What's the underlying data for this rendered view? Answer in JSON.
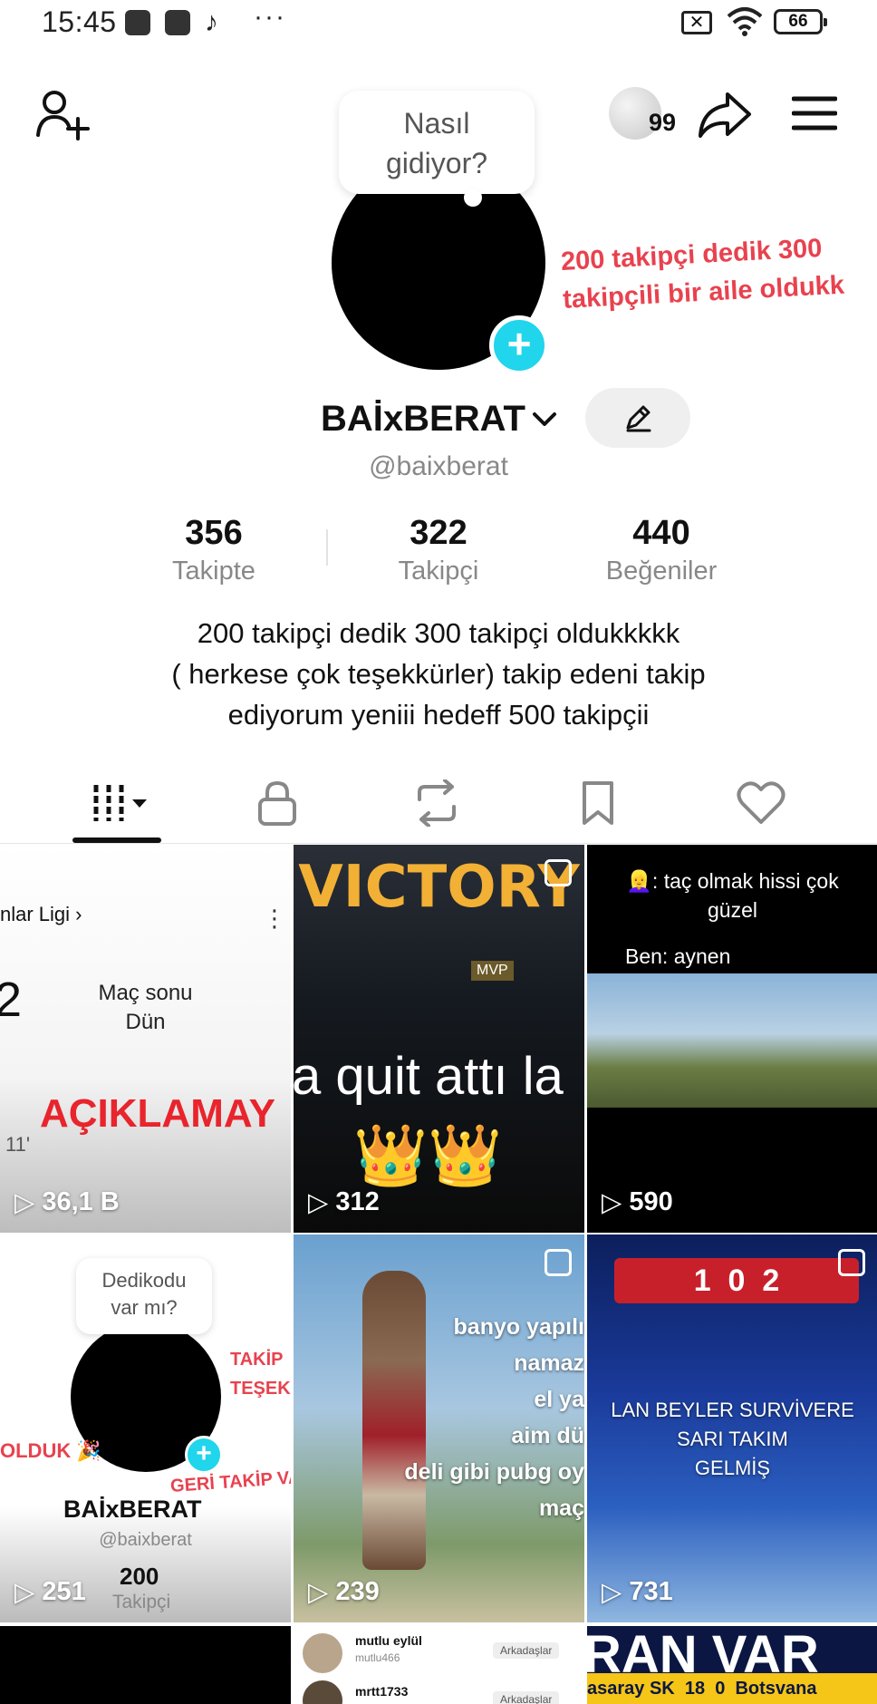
{
  "status": {
    "time": "15:45",
    "dots": "···",
    "battery": "66",
    "close_badge": "✕"
  },
  "header": {
    "coin_count": "99"
  },
  "profile": {
    "bubble_line1": "Nasıl",
    "bubble_line2": "gidiyor?",
    "side_note": "200 takipçi dedik 300 takipçili bir aile oldukk",
    "name": "BAİxBERAT",
    "handle": "@baixberat",
    "stats": [
      {
        "num": "356",
        "label": "Takipte"
      },
      {
        "num": "322",
        "label": "Takipçi"
      },
      {
        "num": "440",
        "label": "Beğeniler"
      }
    ],
    "bio_lines": [
      "200 takipçi dedik 300 takipçi oldukkkkk",
      "( herkese çok teşekkürler) takip edeni takip",
      "ediyorum yeniii hedeff 500 takipçii"
    ]
  },
  "colors": {
    "accent": "#20d5ec",
    "note_red": "#e8424f"
  },
  "videos": [
    {
      "views": "36,1 B",
      "t1": "nlar Ligi ›",
      "t2": "Maç sonu",
      "t3": "Dün",
      "t4": "2",
      "t5": "AÇIKLAMAY",
      "t6": "11'"
    },
    {
      "views": "312",
      "t1": "VICTORY",
      "t2": "a quit attı la",
      "t3": "MVP",
      "crowns": "👑👑"
    },
    {
      "views": "590",
      "t1": "👱‍♀️: taç olmak hissi çok",
      "t2": "güzel",
      "t3": "Ben: aynen"
    },
    {
      "views": "251",
      "t1": "Dedikodu",
      "t2": "var mı?",
      "t3": "BAİxBERAT",
      "t4": "@baixberat",
      "t5": "200",
      "t6": "Takipçi",
      "t7": "OLDUK 🎉",
      "t8": "TAKİP",
      "t9": "TEŞEK",
      "t10": "GERİ TAKİP VA"
    },
    {
      "views": "239",
      "t1": "banyo yapılı",
      "t2": "namaz",
      "t3": "el ya",
      "t4": "aim dü",
      "t5": "deli gibi pubg oy",
      "t6": "maç"
    },
    {
      "views": "731",
      "t1": "LAN BEYLER SURVİVERE",
      "t2": "SARI TAKIM",
      "t3": "GELMİŞ",
      "score": "1  0  2"
    },
    {
      "views": "",
      "t1": ""
    },
    {
      "views": "",
      "t1": "mutlu eylül",
      "t2": "mutlu466",
      "t3": "Arkadaşlar",
      "t4": "mrtt1733",
      "t5": "Arkadaşlar"
    },
    {
      "views": "",
      "t1": "RAN VAR",
      "t2": "asaray SK  18  0  Botsvana"
    }
  ]
}
